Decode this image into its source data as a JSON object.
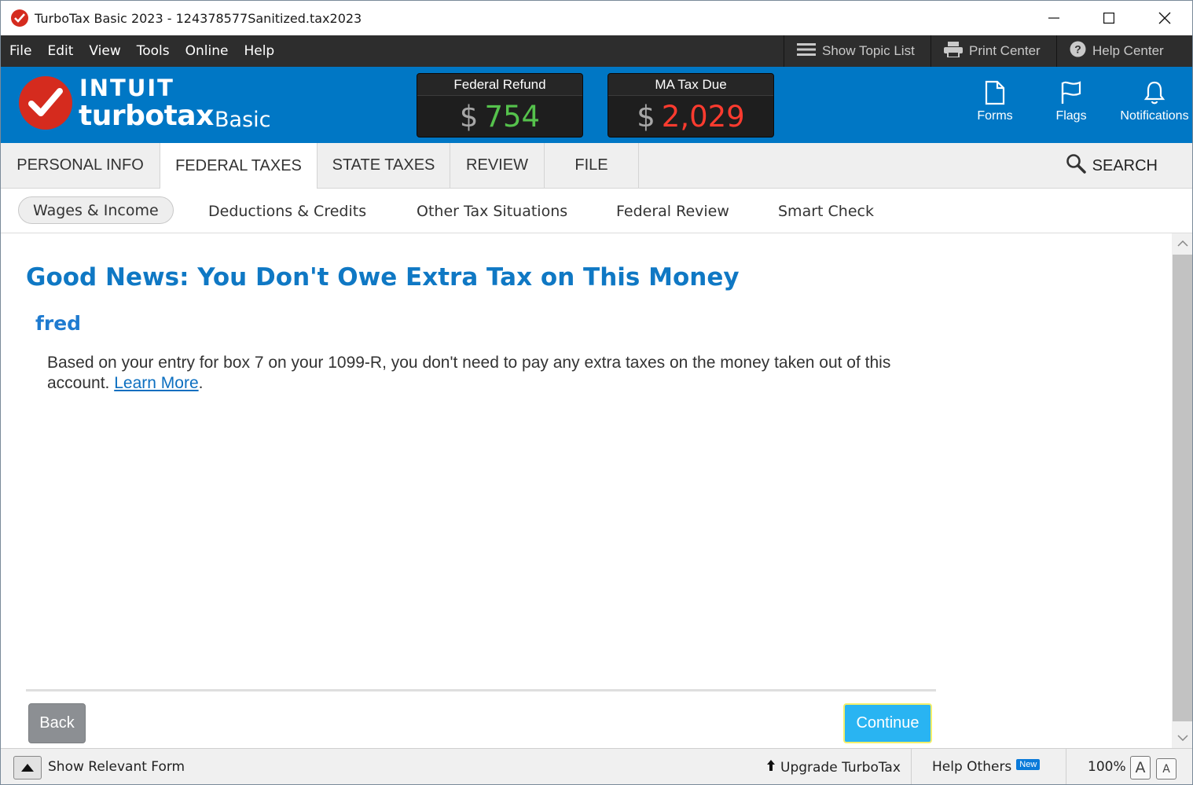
{
  "window": {
    "title": "TurboTax Basic 2023 - 124378577Sanitized.tax2023"
  },
  "menu": {
    "items": [
      "File",
      "Edit",
      "View",
      "Tools",
      "Online",
      "Help"
    ],
    "tools": {
      "topic_list": "Show Topic List",
      "print_center": "Print Center",
      "help_center": "Help Center"
    }
  },
  "header": {
    "logo_intuit": "INTUIT",
    "logo_product": "turbotax",
    "logo_edition": "Basic",
    "federal": {
      "label": "Federal Refund",
      "currency": "$",
      "amount": "754"
    },
    "state": {
      "label": "MA Tax Due",
      "currency": "$",
      "amount": "2,029"
    },
    "buttons": {
      "forms": "Forms",
      "flags": "Flags",
      "notifications": "Notifications"
    }
  },
  "tabs": {
    "items": [
      "PERSONAL INFO",
      "FEDERAL TAXES",
      "STATE TAXES",
      "REVIEW",
      "FILE"
    ],
    "active": "FEDERAL TAXES",
    "search": "SEARCH"
  },
  "subnav": {
    "items": [
      "Wages & Income",
      "Deductions & Credits",
      "Other Tax Situations",
      "Federal Review",
      "Smart Check"
    ],
    "active": "Wages & Income"
  },
  "content": {
    "title": "Good News: You Don't Owe Extra Tax on This Money",
    "name": "fred",
    "body_before": "Based on your entry for box 7 on your 1099-R, you don't need to pay any extra taxes on the money taken out of this account.",
    "link": "Learn More",
    "body_after": ".",
    "back": "Back",
    "continue": "Continue"
  },
  "statusbar": {
    "show_form": "Show Relevant Form",
    "upgrade": "Upgrade TurboTax",
    "help_others": "Help Others",
    "new_badge": "New",
    "zoom": "100%",
    "font_large": "A",
    "font_small": "A"
  },
  "colors": {
    "brand_blue": "#0077c5",
    "brand_red": "#d52b1e",
    "refund_green": "#55c24c",
    "due_red": "#ff3b2f",
    "continue_blue": "#29b4f2"
  }
}
